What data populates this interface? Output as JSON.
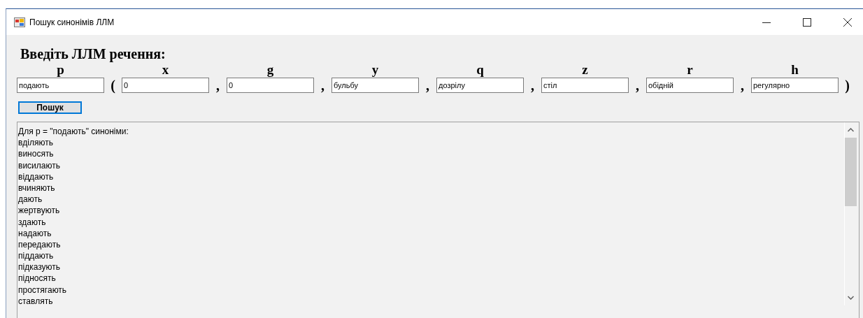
{
  "window": {
    "title": "Пошук синонімів ЛЛМ"
  },
  "heading": "Введіть ЛЛМ речення:",
  "row": [
    {
      "kind": "field",
      "letter": "p",
      "value": "подають"
    },
    {
      "kind": "punct",
      "text": "("
    },
    {
      "kind": "field",
      "letter": "x",
      "value": "0"
    },
    {
      "kind": "punct",
      "text": ","
    },
    {
      "kind": "field",
      "letter": "g",
      "value": "0"
    },
    {
      "kind": "punct",
      "text": ","
    },
    {
      "kind": "field",
      "letter": "y",
      "value": "бульбу"
    },
    {
      "kind": "punct",
      "text": ","
    },
    {
      "kind": "field",
      "letter": "q",
      "value": "дозрілу"
    },
    {
      "kind": "punct",
      "text": ","
    },
    {
      "kind": "field",
      "letter": "z",
      "value": "стіл"
    },
    {
      "kind": "punct",
      "text": ","
    },
    {
      "kind": "field",
      "letter": "r",
      "value": "обідній"
    },
    {
      "kind": "punct",
      "text": ","
    },
    {
      "kind": "field",
      "letter": "h",
      "value": "регулярно"
    },
    {
      "kind": "punct",
      "text": ")"
    }
  ],
  "search_button": "Пошук",
  "results": [
    "Для p = \"подають\" синоніми:",
    "вділяють",
    "виносять",
    "висилають",
    "віддають",
    "вчиняють",
    "дають",
    "жертвують",
    "здають",
    "надають",
    "передають",
    "піддають",
    "підказують",
    "підносять",
    "простягають",
    "ставлять"
  ]
}
